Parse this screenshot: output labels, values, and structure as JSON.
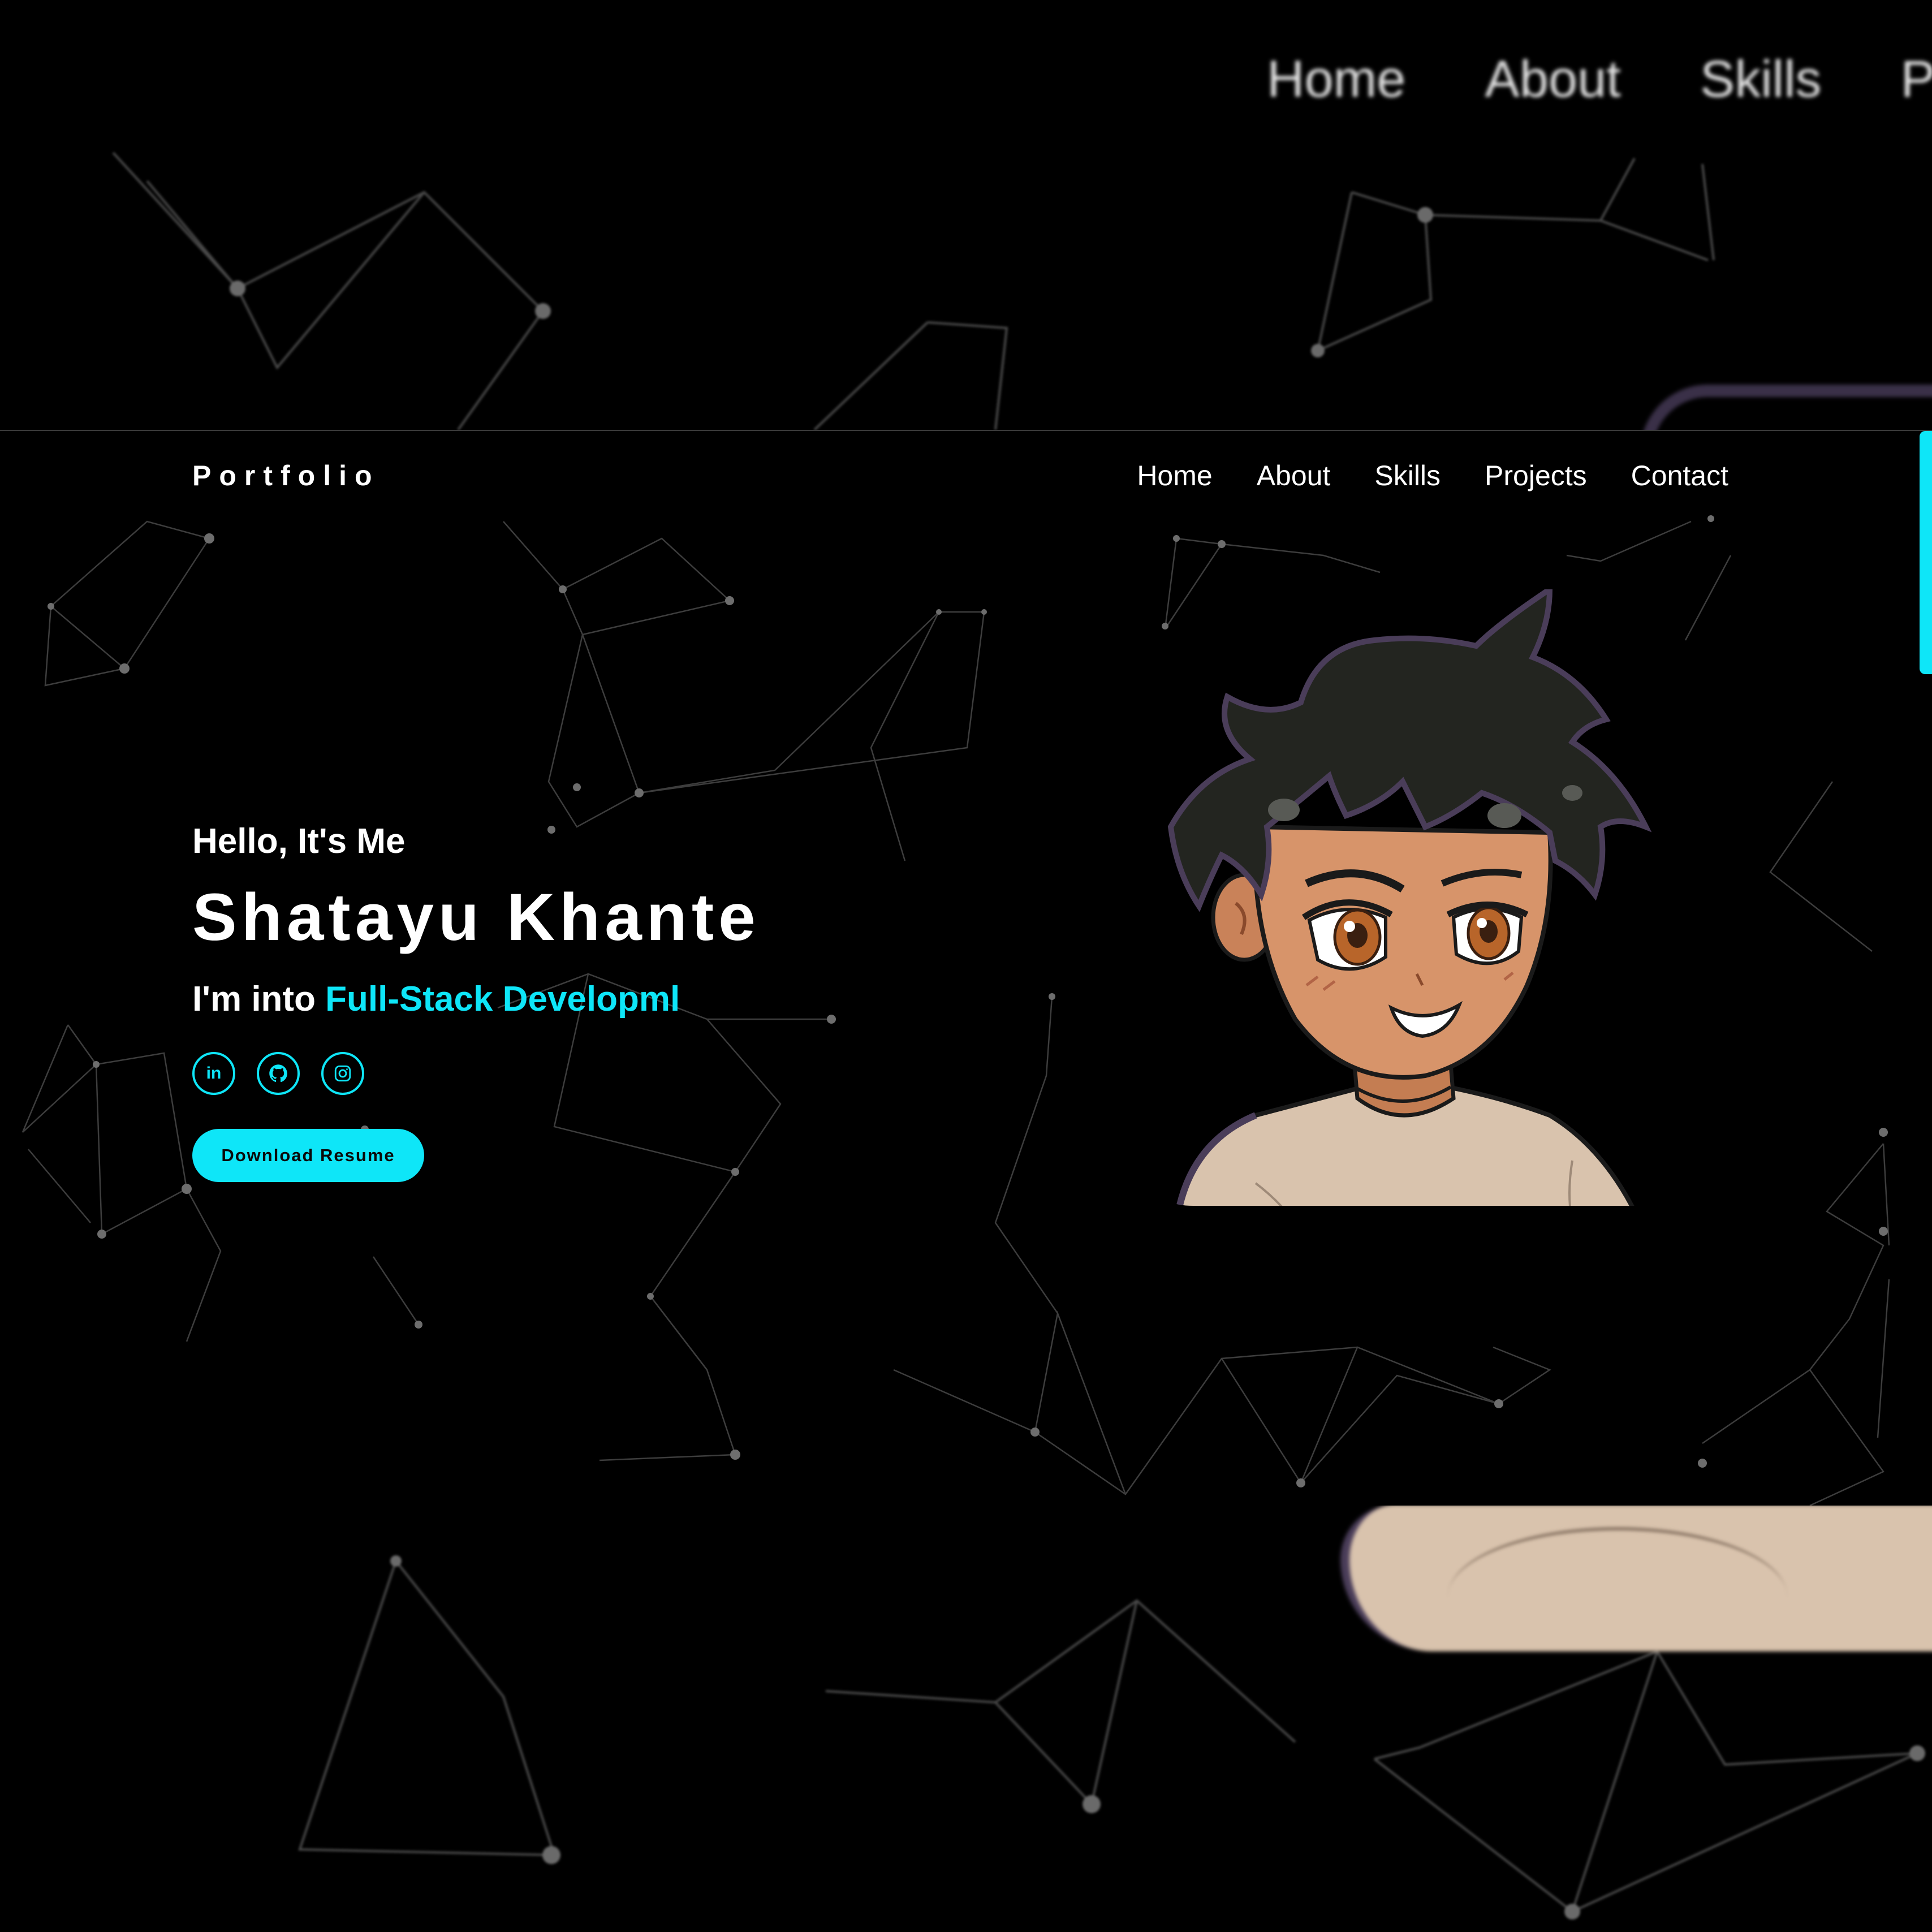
{
  "backdrop": {
    "nav_items": [
      "Home",
      "About",
      "Skills",
      "P"
    ]
  },
  "site": {
    "brand": "Portfolio",
    "nav": {
      "home": "Home",
      "about": "About",
      "skills": "Skills",
      "projects": "Projects",
      "contact": "Contact"
    },
    "hero": {
      "greeting": "Hello, It's Me",
      "name": "Shatayu Khante",
      "role_prefix": "I'm into ",
      "role_typed": "Full-Stack Developml",
      "download_label": "Download Resume"
    },
    "socials": [
      {
        "icon": "linkedin-icon",
        "glyph": "in"
      },
      {
        "icon": "github-icon"
      },
      {
        "icon": "instagram-icon"
      }
    ]
  },
  "colors": {
    "accent": "#0ee6f8",
    "background": "#000000",
    "text": "#ffffff",
    "skin": "#d7946a",
    "hair": "#222320",
    "shirt": "#d9c3ad"
  }
}
